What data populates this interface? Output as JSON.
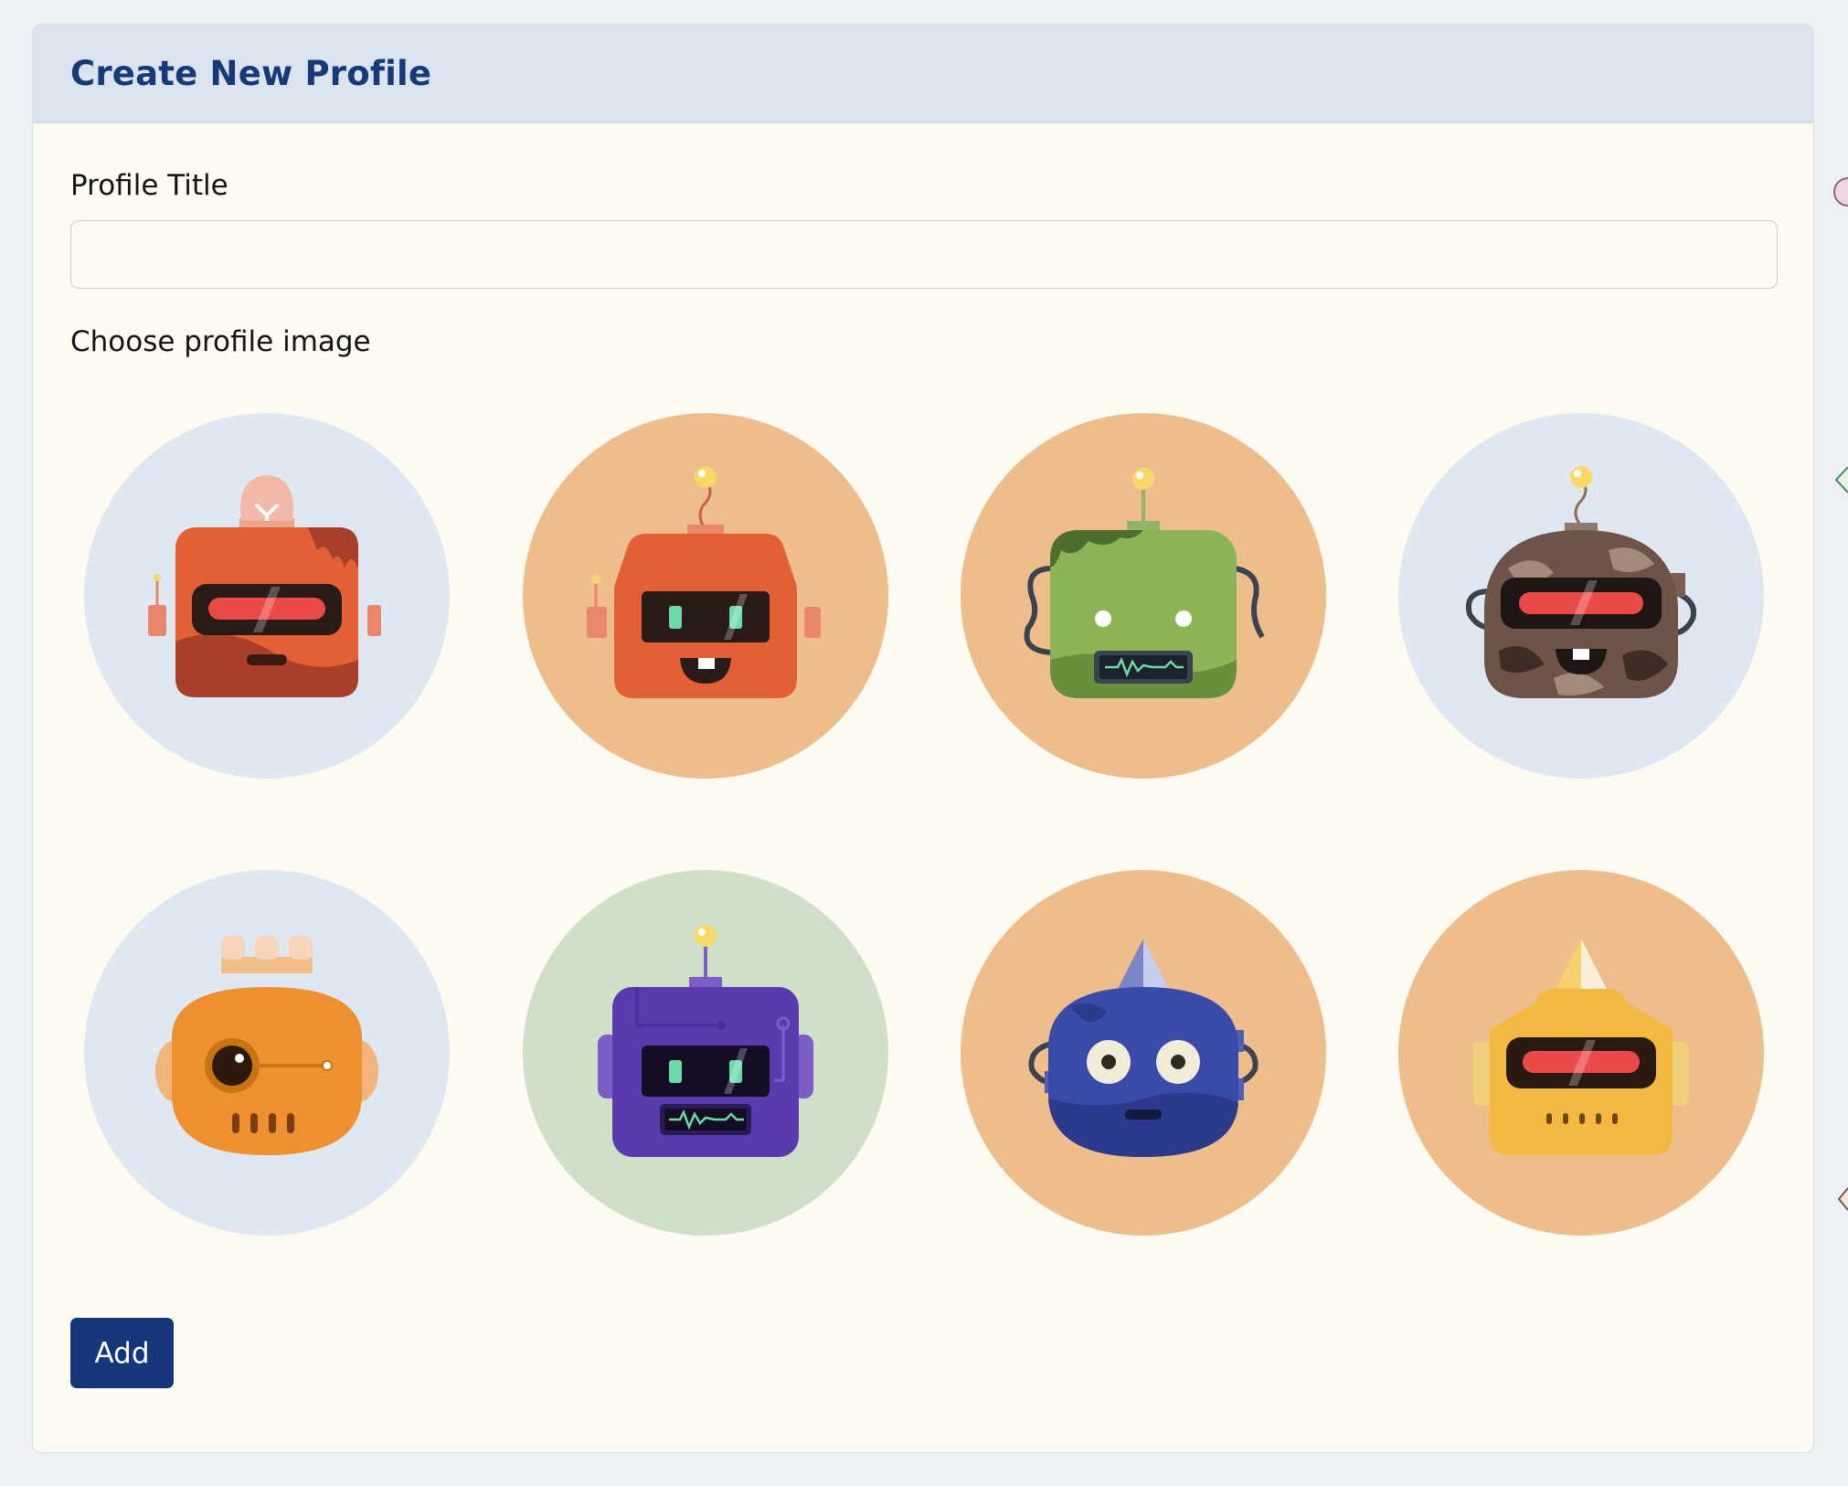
{
  "header": {
    "title": "Create New Profile"
  },
  "form": {
    "title_label": "Profile Title",
    "title_value": "",
    "image_label": "Choose profile image",
    "submit_label": "Add"
  },
  "avatars": [
    {
      "id": "robot-1",
      "description": "orange robot with red visor and light bulb",
      "bg_color": "#dfe7f0"
    },
    {
      "id": "robot-2",
      "description": "orange robot with square green eyes",
      "bg_color": "#edbd8c"
    },
    {
      "id": "robot-3",
      "description": "green zombie robot",
      "bg_color": "#edbd8c"
    },
    {
      "id": "robot-4",
      "description": "camouflage robot with red visor",
      "bg_color": "#dfe7f0"
    },
    {
      "id": "robot-5",
      "description": "orange cyclops robot",
      "bg_color": "#dfe7f0"
    },
    {
      "id": "robot-6",
      "description": "purple robot with green eyes",
      "bg_color": "#d0e0c8"
    },
    {
      "id": "robot-7",
      "description": "blue robot with round eyes",
      "bg_color": "#edbd8c"
    },
    {
      "id": "robot-8",
      "description": "yellow robot with red visor",
      "bg_color": "#edbd8c"
    }
  ],
  "colors": {
    "header_bg": "#dbe3ef",
    "title_color": "#163a79",
    "card_bg": "#fdfaf2",
    "button_bg": "#15367a"
  }
}
